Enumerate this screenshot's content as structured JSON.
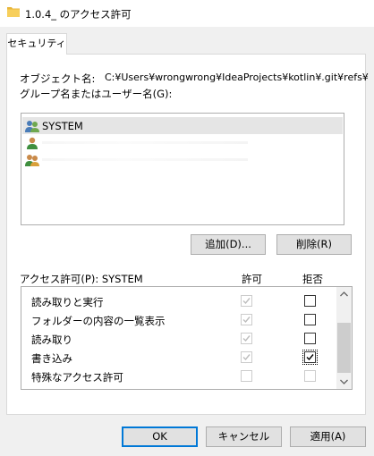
{
  "window": {
    "title": "1.0.4_ のアクセス許可"
  },
  "tab": {
    "label": "セキュリティ"
  },
  "object": {
    "label": "オブジェクト名:",
    "value": "C:¥Users¥wrongwrong¥IdeaProjects¥kotlin¥.git¥refs¥"
  },
  "groups": {
    "label": "グループ名またはユーザー名(G):",
    "items": [
      {
        "name": "SYSTEM",
        "icon": "group-users-icon",
        "selected": true
      },
      {
        "name": "",
        "icon": "single-user-icon",
        "selected": false
      },
      {
        "name": "",
        "icon": "group-users-icon",
        "selected": false
      }
    ]
  },
  "buttons": {
    "add": "追加(D)...",
    "remove": "削除(R)",
    "ok": "OK",
    "cancel": "キャンセル",
    "apply": "適用(A)"
  },
  "permissions": {
    "header": "アクセス許可(P): SYSTEM",
    "allow_header": "許可",
    "deny_header": "拒否",
    "rows": [
      {
        "name": "読み取りと実行",
        "allow": true,
        "allow_enabled": false,
        "deny": false,
        "deny_enabled": true
      },
      {
        "name": "フォルダーの内容の一覧表示",
        "allow": true,
        "allow_enabled": false,
        "deny": false,
        "deny_enabled": true
      },
      {
        "name": "読み取り",
        "allow": true,
        "allow_enabled": false,
        "deny": false,
        "deny_enabled": true
      },
      {
        "name": "書き込み",
        "allow": true,
        "allow_enabled": false,
        "deny": true,
        "deny_enabled": true
      },
      {
        "name": "特殊なアクセス許可",
        "allow": false,
        "allow_enabled": false,
        "deny": false,
        "deny_enabled": false
      }
    ]
  },
  "colors": {
    "accent": "#0078d7",
    "selection": "#e5e5e5"
  }
}
